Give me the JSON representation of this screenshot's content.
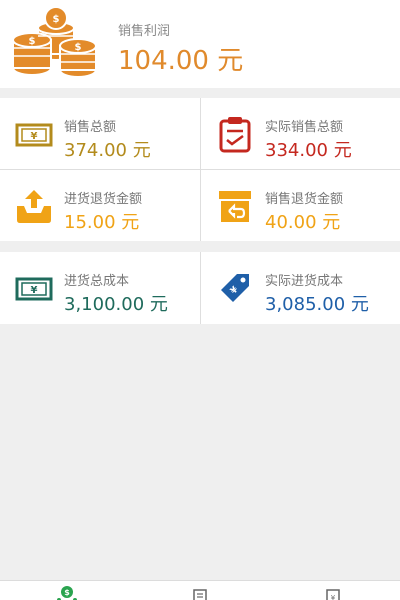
{
  "header": {
    "icon": "coins-stack-icon",
    "profit_label": "销售利润",
    "profit_value": "104.00 元"
  },
  "cards": [
    {
      "icon": "cash-note-icon",
      "label": "销售总额",
      "value": "374.00 元",
      "color": "#b38b1c"
    },
    {
      "icon": "clipboard-check-icon",
      "label": "实际销售总额",
      "value": "334.00 元",
      "color": "#c4281f"
    },
    {
      "icon": "tray-upload-icon",
      "label": "进货退货金额",
      "value": "15.00 元",
      "color": "#f0a316"
    },
    {
      "icon": "box-return-icon",
      "label": "销售退货金额",
      "value": "40.00 元",
      "color": "#f0a316"
    },
    {
      "icon": "cash-note-teal-icon",
      "label": "进货总成本",
      "value": "3,100.00 元",
      "color": "#1f6b5c"
    },
    {
      "icon": "price-tag-icon",
      "label": "实际进货成本",
      "value": "3,085.00 元",
      "color": "#1f5fa8"
    }
  ],
  "tabbar": {
    "icons": [
      "money-tree-icon",
      "document-icon",
      "receipt-icon"
    ]
  }
}
